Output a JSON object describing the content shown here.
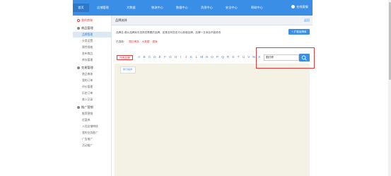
{
  "nav": {
    "items": [
      "首页",
      "店铺管理",
      "大数据",
      "物流中心",
      "数据中心",
      "消息中心",
      "安全中心",
      "帮助中心"
    ],
    "service_label": "在线客服"
  },
  "sidebar": {
    "home_label": "我的商城",
    "groups": [
      {
        "title": "商品管理",
        "items": [
          "品牌管理",
          "分类设置",
          "属性规格",
          "发布商品",
          "库存管理"
        ]
      },
      {
        "title": "交易管理",
        "items": [
          "商品审核",
          "我的订单",
          "评价管理",
          "历史订单",
          "收入记录"
        ]
      },
      {
        "title": "推广营销",
        "items": [
          "推荐营销",
          "优惠券",
          "入驻店铺审核",
          "我的业务推广",
          "广告推广",
          "活动推广"
        ]
      }
    ],
    "active_item": "品牌管理"
  },
  "content": {
    "breadcrumb_title": "品牌选择",
    "back_label": "返回",
    "description": "品牌名:请从品牌库中选择您需要的品牌，如果没有您还可以新增品牌，品牌一旦添加不能修改",
    "apply_button": "+ 扩展品牌库",
    "selected_label": "已选择：",
    "selected_tags": [
      "图灯博品",
      "大数据",
      "图案"
    ],
    "all_brands_label": "所有品牌",
    "letters": [
      "A",
      "B",
      "C",
      "D",
      "E",
      "F",
      "G",
      "H",
      "I",
      "J",
      "K",
      "L",
      "M",
      "N",
      "O",
      "P",
      "Q",
      "R",
      "S",
      "T",
      "U",
      "V",
      "W",
      "X",
      "Y",
      "Z"
    ],
    "search": {
      "value": "图灯博",
      "placeholder": ""
    },
    "brand_card_label": "图灯博品牌"
  },
  "colors": {
    "accent": "#3a8ee6",
    "highlight": "#e4393c",
    "brand_area_bg": "#f4f2e4"
  }
}
